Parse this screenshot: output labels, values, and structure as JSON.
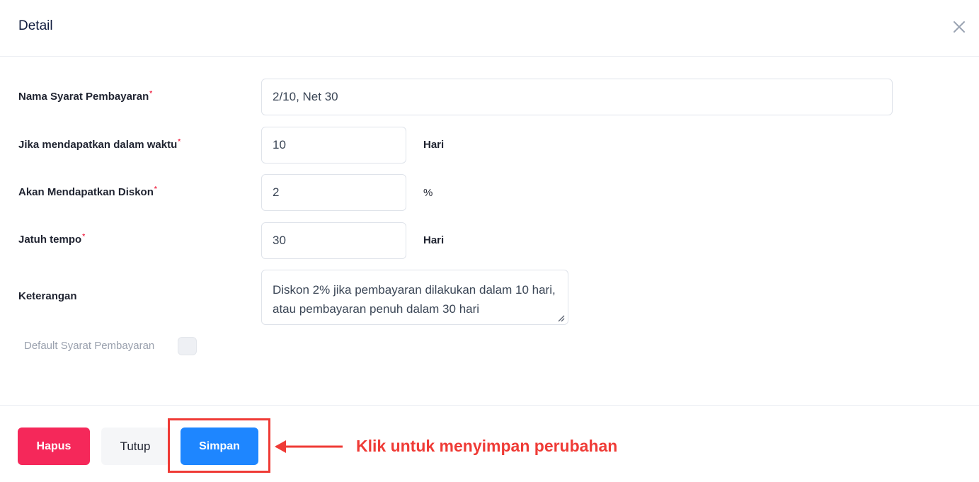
{
  "header": {
    "title": "Detail",
    "close_icon": "close-icon"
  },
  "form": {
    "payment_term_name": {
      "label": "Nama Syarat Pembayaran",
      "required_mark": "*",
      "value": "2/10, Net 30"
    },
    "discount_within": {
      "label": "Jika mendapatkan dalam waktu",
      "required_mark": "*",
      "value": "10",
      "unit": "Hari"
    },
    "discount": {
      "label": "Akan Mendapatkan Diskon",
      "required_mark": "*",
      "value": "2",
      "unit": "%"
    },
    "due_date": {
      "label": "Jatuh tempo",
      "required_mark": "*",
      "value": "30",
      "unit": "Hari"
    },
    "description": {
      "label": "Keterangan",
      "value": "Diskon 2% jika pembayaran dilakukan dalam 10 hari, atau pembayaran penuh dalam 30 hari"
    },
    "default_term": {
      "label": "Default Syarat Pembayaran",
      "checked": false
    }
  },
  "footer": {
    "delete_label": "Hapus",
    "close_label": "Tutup",
    "save_label": "Simpan"
  },
  "annotation": {
    "text": "Klik untuk menyimpan perubahan",
    "color": "#ef3b36"
  },
  "colors": {
    "primary": "#1e86ff",
    "danger": "#f5285a",
    "required": "#f0314f"
  }
}
